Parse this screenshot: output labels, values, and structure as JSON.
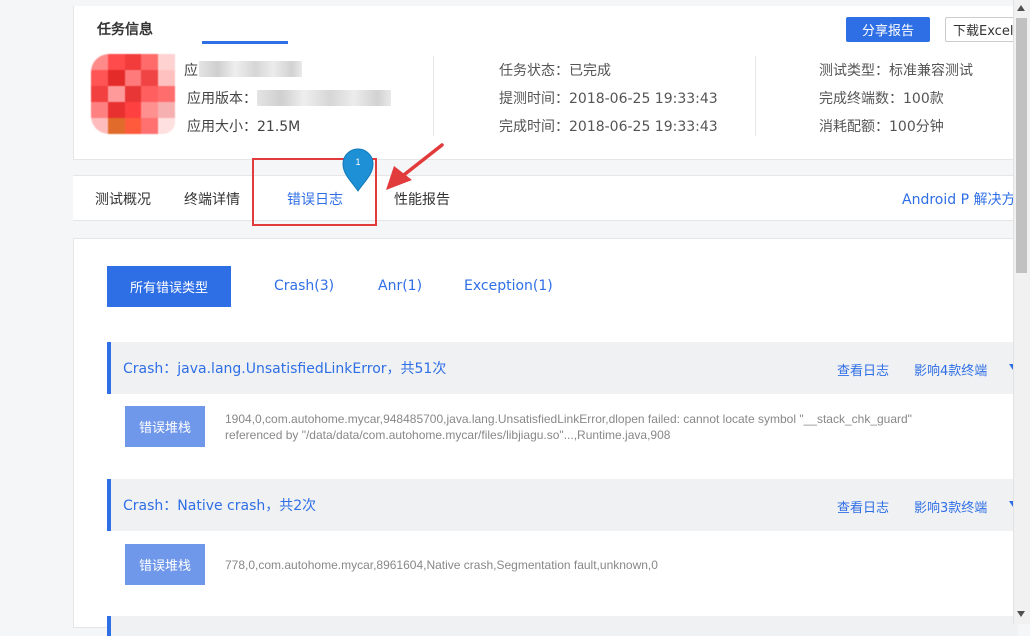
{
  "task_info": {
    "title": "任务信息",
    "share_button": "分享报告",
    "download_button": "下载Excel报",
    "app_name_label": "应",
    "app_version_label": "应用版本：",
    "app_size": "应用大小：21.5M",
    "task_status": "任务状态：已完成",
    "submit_time": "提测时间：2018-06-25 19:33:43",
    "finish_time": "完成时间：2018-06-25 19:33:43",
    "test_type": "测试类型：标准兼容测试",
    "finished_devices": "完成终端数：100款",
    "quota_used": "消耗配额：100分钟"
  },
  "tabs": {
    "overview": "测试概况",
    "device_details": "终端详情",
    "error_log": "错误日志",
    "performance": "性能报告",
    "solution_link": "Android P 解决方"
  },
  "marker": {
    "number": "1"
  },
  "filters": {
    "all": "所有错误类型",
    "crash": "Crash(3)",
    "anr": "Anr(1)",
    "exception": "Exception(1)"
  },
  "errors": [
    {
      "title": "Crash：java.lang.UnsatisfiedLinkError，共51次",
      "view_log": "查看日志",
      "impact": "影响4款终端",
      "stack_button": "错误堆栈",
      "stack_line1": "1904,0,com.autohome.mycar,948485700,java.lang.UnsatisfiedLinkError,dlopen failed: cannot locate symbol \"__stack_chk_guard\"",
      "stack_line2": "referenced by \"/data/data/com.autohome.mycar/files/libjiagu.so\"...,Runtime.java,908"
    },
    {
      "title": "Crash：Native crash，共2次",
      "view_log": "查看日志",
      "impact": "影响3款终端",
      "stack_button": "错误堆栈",
      "stack_line1": "778,0,com.autohome.mycar,8961604,Native crash,Segmentation fault,unknown,0"
    }
  ],
  "colors": {
    "accent": "#2f6fe6",
    "annotation_red": "#e23b3b",
    "marker_blue": "#1e90d6"
  }
}
